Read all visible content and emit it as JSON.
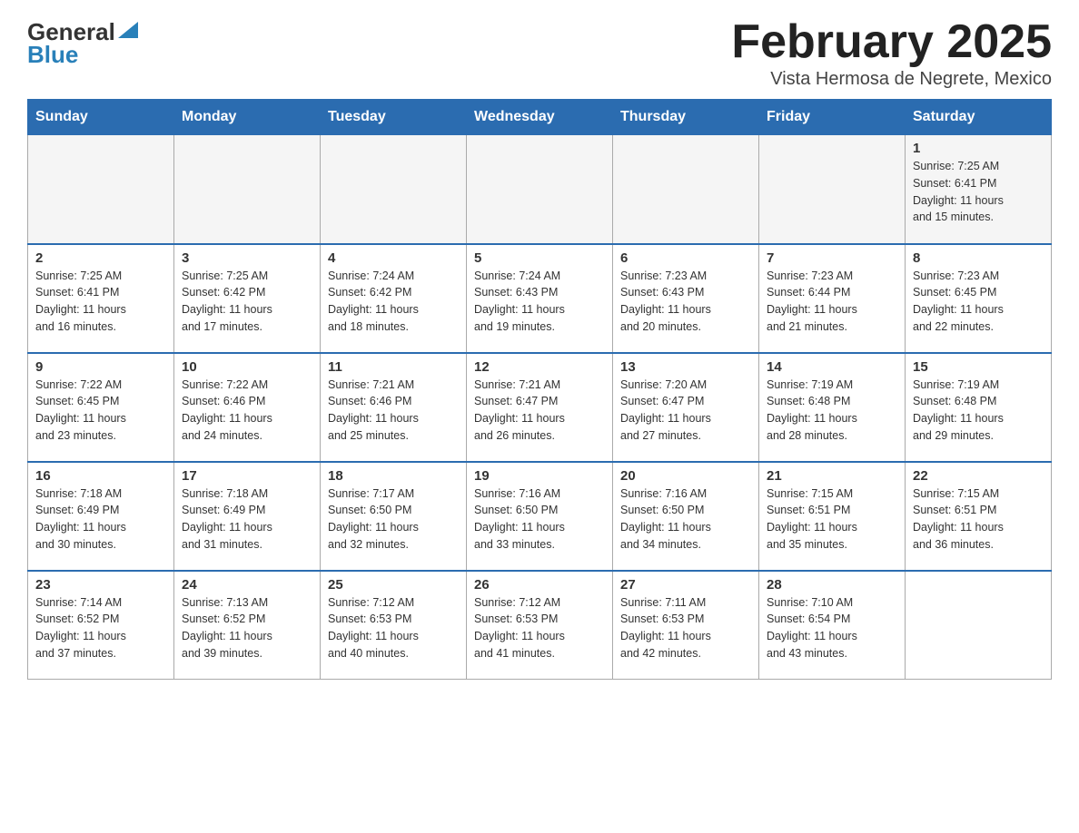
{
  "header": {
    "logo_general": "General",
    "logo_blue": "Blue",
    "month_title": "February 2025",
    "location": "Vista Hermosa de Negrete, Mexico"
  },
  "weekdays": [
    "Sunday",
    "Monday",
    "Tuesday",
    "Wednesday",
    "Thursday",
    "Friday",
    "Saturday"
  ],
  "weeks": [
    [
      {
        "day": "",
        "info": ""
      },
      {
        "day": "",
        "info": ""
      },
      {
        "day": "",
        "info": ""
      },
      {
        "day": "",
        "info": ""
      },
      {
        "day": "",
        "info": ""
      },
      {
        "day": "",
        "info": ""
      },
      {
        "day": "1",
        "info": "Sunrise: 7:25 AM\nSunset: 6:41 PM\nDaylight: 11 hours\nand 15 minutes."
      }
    ],
    [
      {
        "day": "2",
        "info": "Sunrise: 7:25 AM\nSunset: 6:41 PM\nDaylight: 11 hours\nand 16 minutes."
      },
      {
        "day": "3",
        "info": "Sunrise: 7:25 AM\nSunset: 6:42 PM\nDaylight: 11 hours\nand 17 minutes."
      },
      {
        "day": "4",
        "info": "Sunrise: 7:24 AM\nSunset: 6:42 PM\nDaylight: 11 hours\nand 18 minutes."
      },
      {
        "day": "5",
        "info": "Sunrise: 7:24 AM\nSunset: 6:43 PM\nDaylight: 11 hours\nand 19 minutes."
      },
      {
        "day": "6",
        "info": "Sunrise: 7:23 AM\nSunset: 6:43 PM\nDaylight: 11 hours\nand 20 minutes."
      },
      {
        "day": "7",
        "info": "Sunrise: 7:23 AM\nSunset: 6:44 PM\nDaylight: 11 hours\nand 21 minutes."
      },
      {
        "day": "8",
        "info": "Sunrise: 7:23 AM\nSunset: 6:45 PM\nDaylight: 11 hours\nand 22 minutes."
      }
    ],
    [
      {
        "day": "9",
        "info": "Sunrise: 7:22 AM\nSunset: 6:45 PM\nDaylight: 11 hours\nand 23 minutes."
      },
      {
        "day": "10",
        "info": "Sunrise: 7:22 AM\nSunset: 6:46 PM\nDaylight: 11 hours\nand 24 minutes."
      },
      {
        "day": "11",
        "info": "Sunrise: 7:21 AM\nSunset: 6:46 PM\nDaylight: 11 hours\nand 25 minutes."
      },
      {
        "day": "12",
        "info": "Sunrise: 7:21 AM\nSunset: 6:47 PM\nDaylight: 11 hours\nand 26 minutes."
      },
      {
        "day": "13",
        "info": "Sunrise: 7:20 AM\nSunset: 6:47 PM\nDaylight: 11 hours\nand 27 minutes."
      },
      {
        "day": "14",
        "info": "Sunrise: 7:19 AM\nSunset: 6:48 PM\nDaylight: 11 hours\nand 28 minutes."
      },
      {
        "day": "15",
        "info": "Sunrise: 7:19 AM\nSunset: 6:48 PM\nDaylight: 11 hours\nand 29 minutes."
      }
    ],
    [
      {
        "day": "16",
        "info": "Sunrise: 7:18 AM\nSunset: 6:49 PM\nDaylight: 11 hours\nand 30 minutes."
      },
      {
        "day": "17",
        "info": "Sunrise: 7:18 AM\nSunset: 6:49 PM\nDaylight: 11 hours\nand 31 minutes."
      },
      {
        "day": "18",
        "info": "Sunrise: 7:17 AM\nSunset: 6:50 PM\nDaylight: 11 hours\nand 32 minutes."
      },
      {
        "day": "19",
        "info": "Sunrise: 7:16 AM\nSunset: 6:50 PM\nDaylight: 11 hours\nand 33 minutes."
      },
      {
        "day": "20",
        "info": "Sunrise: 7:16 AM\nSunset: 6:50 PM\nDaylight: 11 hours\nand 34 minutes."
      },
      {
        "day": "21",
        "info": "Sunrise: 7:15 AM\nSunset: 6:51 PM\nDaylight: 11 hours\nand 35 minutes."
      },
      {
        "day": "22",
        "info": "Sunrise: 7:15 AM\nSunset: 6:51 PM\nDaylight: 11 hours\nand 36 minutes."
      }
    ],
    [
      {
        "day": "23",
        "info": "Sunrise: 7:14 AM\nSunset: 6:52 PM\nDaylight: 11 hours\nand 37 minutes."
      },
      {
        "day": "24",
        "info": "Sunrise: 7:13 AM\nSunset: 6:52 PM\nDaylight: 11 hours\nand 39 minutes."
      },
      {
        "day": "25",
        "info": "Sunrise: 7:12 AM\nSunset: 6:53 PM\nDaylight: 11 hours\nand 40 minutes."
      },
      {
        "day": "26",
        "info": "Sunrise: 7:12 AM\nSunset: 6:53 PM\nDaylight: 11 hours\nand 41 minutes."
      },
      {
        "day": "27",
        "info": "Sunrise: 7:11 AM\nSunset: 6:53 PM\nDaylight: 11 hours\nand 42 minutes."
      },
      {
        "day": "28",
        "info": "Sunrise: 7:10 AM\nSunset: 6:54 PM\nDaylight: 11 hours\nand 43 minutes."
      },
      {
        "day": "",
        "info": ""
      }
    ]
  ]
}
